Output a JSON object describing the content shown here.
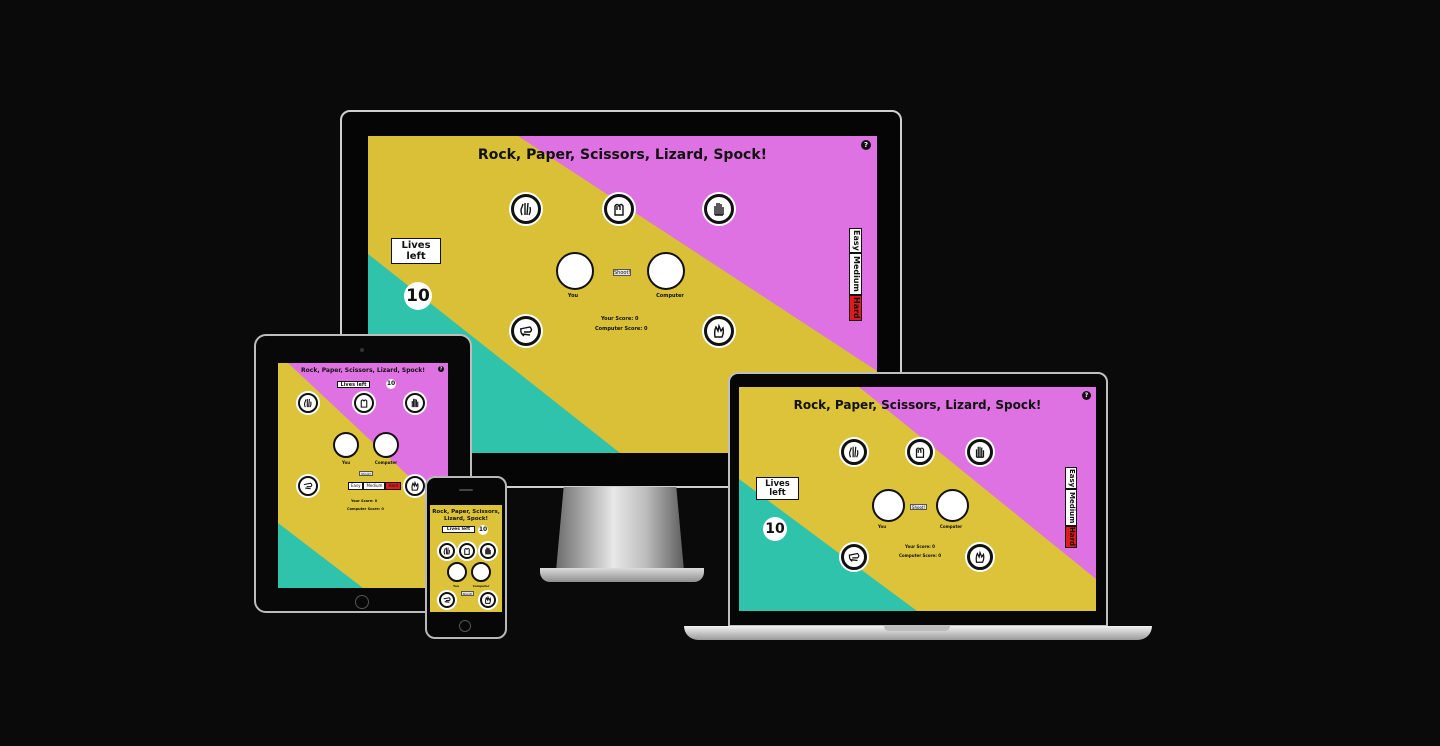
{
  "game": {
    "title": "Rock, Paper, Scissors, Lizard, Spock!",
    "title_phone_line1": "Rock, Paper, Scissors,",
    "title_phone_line2": "Lizard, Spock!",
    "help": "?",
    "lives_label": "Lives left",
    "lives_line1": "Lives",
    "lives_line2": "left",
    "lives_value": "10",
    "shoot_label": "Shoot!",
    "you_label": "You",
    "computer_label": "Computer",
    "your_score": "Your Score: 0",
    "computer_score": "Computer Score: 0",
    "difficulty": [
      "Easy",
      "Medium",
      "Hard"
    ],
    "choices": [
      "scissors-icon",
      "rock-icon",
      "paper-icon",
      "lizard-icon",
      "spock-icon"
    ]
  },
  "colors": {
    "background": "#0b0a0a",
    "yellow": "#dcc33a",
    "pink": "#df72e2",
    "teal": "#2ec3aa",
    "hard": "#e01b1b"
  }
}
